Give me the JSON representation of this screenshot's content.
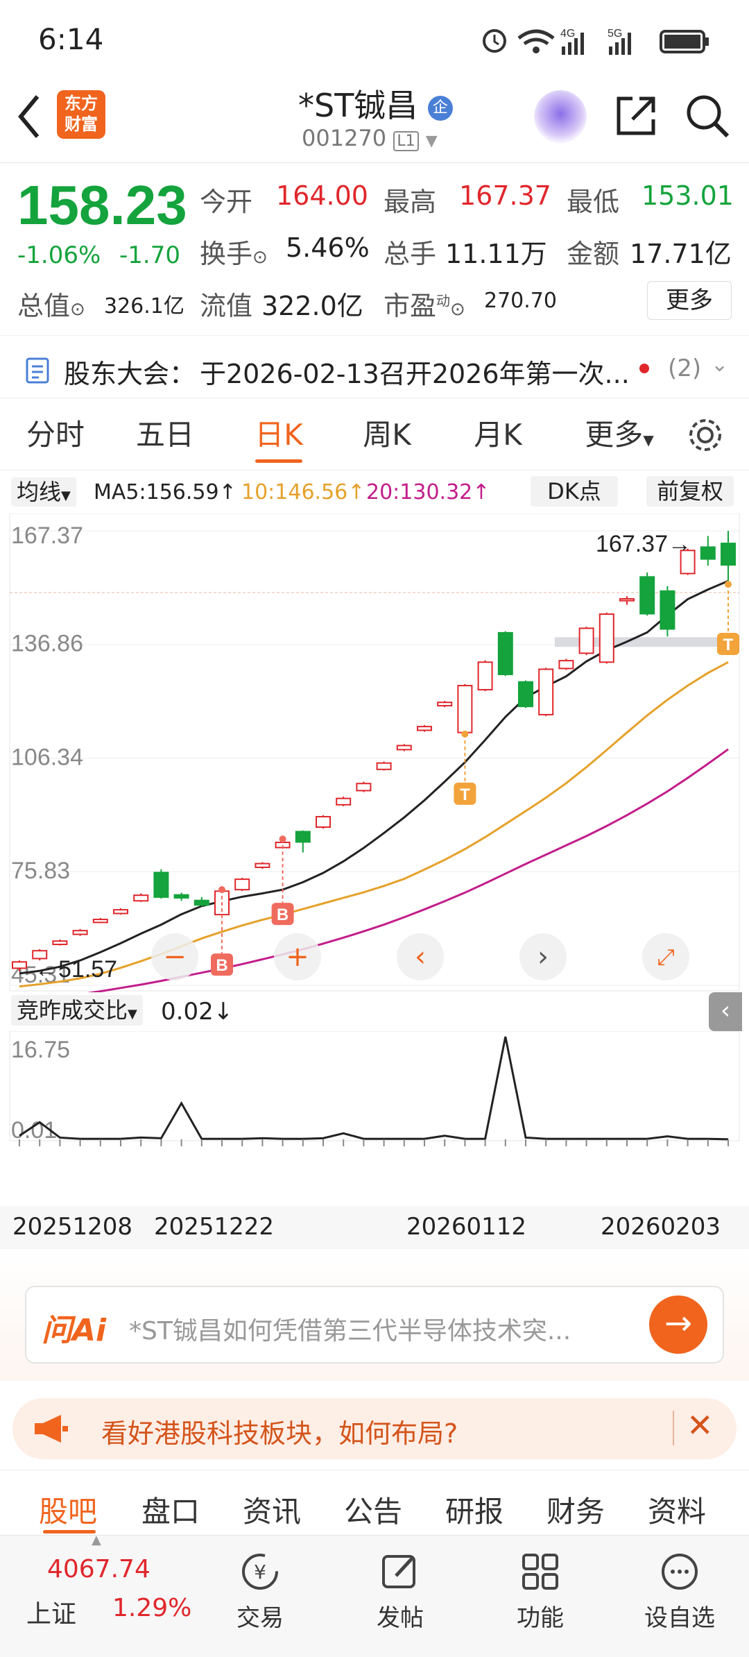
{
  "status_bar": {
    "time": "6:14",
    "network_left": "4G",
    "network_right": "5G"
  },
  "header": {
    "logo_line1": "东方",
    "logo_line2": "财富",
    "stock_name": "*ST铖昌",
    "badge": "企",
    "stock_code": "001270",
    "level": "L1"
  },
  "quote": {
    "price": "158.23",
    "change_pct": "-1.06%",
    "change": "-1.70",
    "open_label": "今开",
    "open": "164.00",
    "high_label": "最高",
    "high": "167.37",
    "low_label": "最低",
    "low": "153.01",
    "turnover_label": "换手",
    "turnover": "5.46%",
    "volume_label": "总手",
    "volume": "11.11万",
    "amount_label": "金额",
    "amount": "17.71亿",
    "mcap_label": "总值",
    "mcap": "326.1亿",
    "float_label": "流值",
    "float": "322.0亿",
    "pe_label": "市盈",
    "pe_sup": "动",
    "pe": "270.70",
    "more_label": "更多"
  },
  "notice": {
    "label": "股东大会：",
    "text": "于2026-02-13召开2026年第一次...",
    "count": "(2)"
  },
  "tabs": [
    "分时",
    "五日",
    "日K",
    "周K",
    "月K",
    "更多"
  ],
  "chart_legend": {
    "ma_label": "均线",
    "ma5": "MA5:156.59↑",
    "ma10": "10:146.56↑",
    "ma20": "20:130.32↑",
    "dk_label": "DK点",
    "adj_label": "前复权"
  },
  "chart_data": [
    {
      "type": "candlestick",
      "y_ticks": [
        "167.37",
        "136.86",
        "106.34",
        "75.83",
        "45.31"
      ],
      "ylim": [
        45.31,
        167.37
      ],
      "high_marker": "167.37",
      "low_marker": "51.57",
      "x_labels": [
        "20251208",
        "20251222",
        "20260112",
        "20260203"
      ],
      "candles": [
        {
          "o": 49.9,
          "c": 51.6,
          "h": 52.0,
          "l": 49.0
        },
        {
          "o": 52.5,
          "c": 54.6,
          "h": 55.0,
          "l": 52.0
        },
        {
          "o": 56.3,
          "c": 57.2,
          "h": 57.6,
          "l": 56.0
        },
        {
          "o": 59.0,
          "c": 60.0,
          "h": 60.4,
          "l": 58.6
        },
        {
          "o": 62.2,
          "c": 63.0,
          "h": 63.4,
          "l": 62.0
        },
        {
          "o": 64.6,
          "c": 65.6,
          "h": 66.0,
          "l": 64.3
        },
        {
          "o": 68.0,
          "c": 69.5,
          "h": 70.0,
          "l": 67.7
        },
        {
          "o": 75.6,
          "c": 69.0,
          "h": 76.5,
          "l": 68.6
        },
        {
          "o": 69.6,
          "c": 68.8,
          "h": 70.2,
          "l": 68.0
        },
        {
          "o": 68.1,
          "c": 66.9,
          "h": 69.0,
          "l": 66.5
        },
        {
          "o": 64.3,
          "c": 70.6,
          "h": 71.0,
          "l": 63.9
        },
        {
          "o": 71.0,
          "c": 73.8,
          "h": 74.2,
          "l": 70.6
        },
        {
          "o": 77.0,
          "c": 78.0,
          "h": 78.4,
          "l": 76.6
        },
        {
          "o": 82.3,
          "c": 83.7,
          "h": 84.6,
          "l": 82.0
        },
        {
          "o": 86.6,
          "c": 83.8,
          "h": 86.9,
          "l": 81.0
        },
        {
          "o": 87.8,
          "c": 90.6,
          "h": 91.0,
          "l": 87.4
        },
        {
          "o": 93.8,
          "c": 95.5,
          "h": 96.0,
          "l": 93.4
        },
        {
          "o": 97.6,
          "c": 99.5,
          "h": 100.0,
          "l": 97.2
        },
        {
          "o": 103.3,
          "c": 105.0,
          "h": 105.4,
          "l": 103.0
        },
        {
          "o": 108.6,
          "c": 109.7,
          "h": 110.1,
          "l": 108.2
        },
        {
          "o": 113.8,
          "c": 114.8,
          "h": 115.2,
          "l": 113.4
        },
        {
          "o": 120.4,
          "c": 121.3,
          "h": 121.7,
          "l": 120.0
        },
        {
          "o": 113.2,
          "c": 125.8,
          "h": 126.2,
          "l": 112.8
        },
        {
          "o": 124.7,
          "c": 132.1,
          "h": 132.6,
          "l": 124.3
        },
        {
          "o": 140.0,
          "c": 128.8,
          "h": 140.4,
          "l": 128.4
        },
        {
          "o": 126.8,
          "c": 120.2,
          "h": 127.2,
          "l": 119.8
        },
        {
          "o": 118.0,
          "c": 130.2,
          "h": 130.6,
          "l": 117.6
        },
        {
          "o": 130.4,
          "c": 132.5,
          "h": 133.0,
          "l": 130.0
        },
        {
          "o": 134.5,
          "c": 141.2,
          "h": 141.6,
          "l": 134.0
        },
        {
          "o": 132.1,
          "c": 145.0,
          "h": 145.4,
          "l": 131.7
        },
        {
          "o": 148.6,
          "c": 149.1,
          "h": 149.8,
          "l": 147.5
        },
        {
          "o": 155.0,
          "c": 145.1,
          "h": 156.2,
          "l": 144.6
        },
        {
          "o": 151.2,
          "c": 141.0,
          "h": 152.5,
          "l": 139.0
        },
        {
          "o": 155.9,
          "c": 162.1,
          "h": 162.6,
          "l": 155.5
        },
        {
          "o": 163.0,
          "c": 159.8,
          "h": 166.0,
          "l": 158.0
        },
        {
          "o": 164.0,
          "c": 158.2,
          "h": 167.37,
          "l": 153.01
        }
      ],
      "ma5": [
        48.5,
        49.2,
        50.3,
        52.0,
        54.2,
        56.6,
        59.2,
        61.6,
        64.4,
        66.6,
        67.9,
        69.1,
        70.0,
        71.0,
        73.0,
        75.5,
        78.6,
        82.2,
        86.2,
        90.4,
        95.0,
        100.0,
        105.2,
        111.2,
        117.4,
        122.6,
        125.6,
        128.3,
        132.3,
        135.3,
        137.6,
        140.1,
        144.7,
        149.0,
        151.6,
        153.9
      ],
      "ma10": [
        45.0,
        45.6,
        46.3,
        47.2,
        48.4,
        50.0,
        51.8,
        53.7,
        55.8,
        57.9,
        59.7,
        61.4,
        62.9,
        64.3,
        65.8,
        67.3,
        68.8,
        70.3,
        72.0,
        73.9,
        76.4,
        79.0,
        81.9,
        85.1,
        88.6,
        92.1,
        95.7,
        99.6,
        103.9,
        108.5,
        113.2,
        117.8,
        122.0,
        125.8,
        129.2,
        132.1
      ],
      "ma20": [
        40.5,
        41.3,
        42.1,
        42.9,
        43.7,
        44.6,
        45.5,
        46.5,
        47.6,
        48.7,
        49.8,
        51.0,
        52.3,
        53.6,
        55.0,
        56.5,
        58.1,
        59.8,
        61.6,
        63.6,
        65.7,
        67.9,
        70.2,
        72.7,
        75.3,
        77.9,
        80.4,
        82.9,
        85.4,
        88.1,
        91.0,
        94.1,
        97.4,
        101.0,
        104.8,
        108.7
      ],
      "signals": [
        {
          "i": 10,
          "type": "B"
        },
        {
          "i": 13,
          "type": "B"
        },
        {
          "i": 22,
          "type": "T"
        },
        {
          "i": 35,
          "type": "T"
        }
      ]
    },
    {
      "type": "line",
      "title": "竞昨成交比",
      "current": "0.02↓",
      "y_ticks": [
        "16.75",
        "0.01"
      ],
      "ylim": [
        0.01,
        16.75
      ],
      "values": [
        0.6,
        2.8,
        0.3,
        0.1,
        0.1,
        0.1,
        0.3,
        0.2,
        5.9,
        0.1,
        0.1,
        0.1,
        0.2,
        0.1,
        0.1,
        0.2,
        1.0,
        0.1,
        0.1,
        0.1,
        0.1,
        0.6,
        0.1,
        0.1,
        16.75,
        0.3,
        0.1,
        0.1,
        0.1,
        0.1,
        0.1,
        0.1,
        0.5,
        0.1,
        0.1,
        0.02
      ]
    }
  ],
  "ai_bar": {
    "label": "问Ai",
    "placeholder": "*ST铖昌如何凭借第三代半导体技术突..."
  },
  "promo": {
    "text": "看好港股科技板块，如何布局?"
  },
  "bottom_tabs": [
    "股吧",
    "盘口",
    "资讯",
    "公告",
    "研报",
    "财务",
    "资料"
  ],
  "footer": {
    "index_value": "4067.74",
    "index_name": "上证",
    "index_pct": "1.29%",
    "trade": "交易",
    "post": "发帖",
    "function": "功能",
    "watch": "设自选"
  }
}
